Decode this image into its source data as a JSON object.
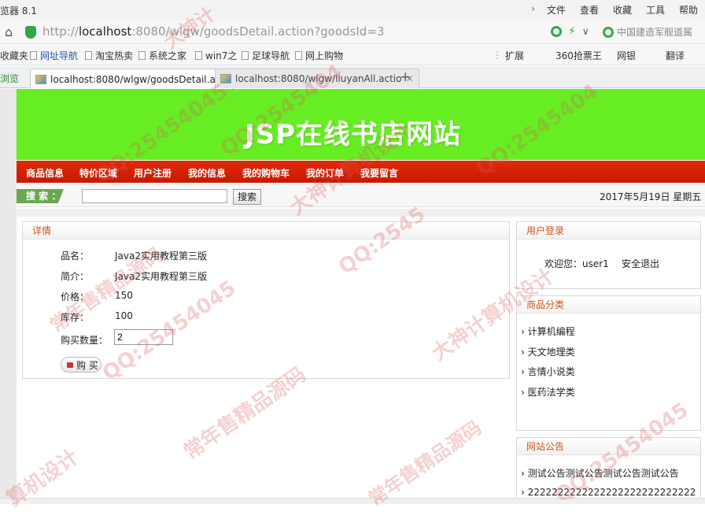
{
  "browser": {
    "app_name": "览器 8.1",
    "menu": [
      "文件",
      "查看",
      "收藏",
      "工具",
      "帮助"
    ],
    "url_prefix": "http://",
    "url_host": "localhost",
    "url_rest": ":8080/wlgw/goodsDetail.action?goodsId=3",
    "search_engine": "中国建造军舰道属",
    "bookmarks": [
      "收藏夹",
      "网址导航",
      "淘宝热卖",
      "系统之家",
      "win7之",
      "足球导航",
      "网上购物"
    ],
    "extensions": [
      "扩展",
      "360抢票王",
      "网银",
      "翻译"
    ],
    "side_label": "浏览",
    "tabs": [
      {
        "label": "localhost:8080/wlgw/goodsDetail.a"
      },
      {
        "label": "localhost:8080/wlgw/liuyanAll.actio"
      }
    ],
    "new_tab": "+"
  },
  "site": {
    "title": "JSP在线书店网站",
    "nav": [
      "商品信息",
      "特价区域",
      "用户注册",
      "我的信息",
      "我的购物车",
      "我的订单",
      "我要留言"
    ],
    "search_label": "搜 索 ：",
    "search_button": "搜索",
    "search_value": "",
    "date": "2017年5月19日 星期五"
  },
  "detail": {
    "heading": "详情",
    "name_label": "品名：",
    "name_value": "Java2实用教程第三版",
    "intro_label": "简介：",
    "intro_value": "Java2实用教程第三版",
    "price_label": "价格：",
    "price_value": "150",
    "stock_label": "库存：",
    "stock_value": "100",
    "qty_label": "购买数量：",
    "qty_value": "2",
    "buy_label": "购 买"
  },
  "login": {
    "heading": "用户登录",
    "welcome": "欢迎您：user1",
    "logout": "安全退出"
  },
  "categories": {
    "heading": "商品分类",
    "items": [
      "计算机编程",
      "天文地理类",
      "言情小说类",
      "医药法学类"
    ]
  },
  "notices": {
    "heading": "网站公告",
    "items": [
      "测试公告测试公告测试公告测试公告",
      "2222222222222222222222222222"
    ]
  },
  "watermarks": [
    "QQ:25454045",
    "大神计",
    "算机设计",
    "常年售精品源码",
    "QQ:2545404",
    "大神计算机设计",
    "QQ:25454045",
    "常年售精品源码",
    "QQ:2545",
    "大神计算机设计",
    "QQ:2545404",
    "常年售精品源码",
    "QQ:25454045"
  ],
  "colors": {
    "banner": "#66ee22",
    "navbar": "#d42208",
    "panel_heading": "#d0541a",
    "search_tag": "#6aa84f"
  }
}
